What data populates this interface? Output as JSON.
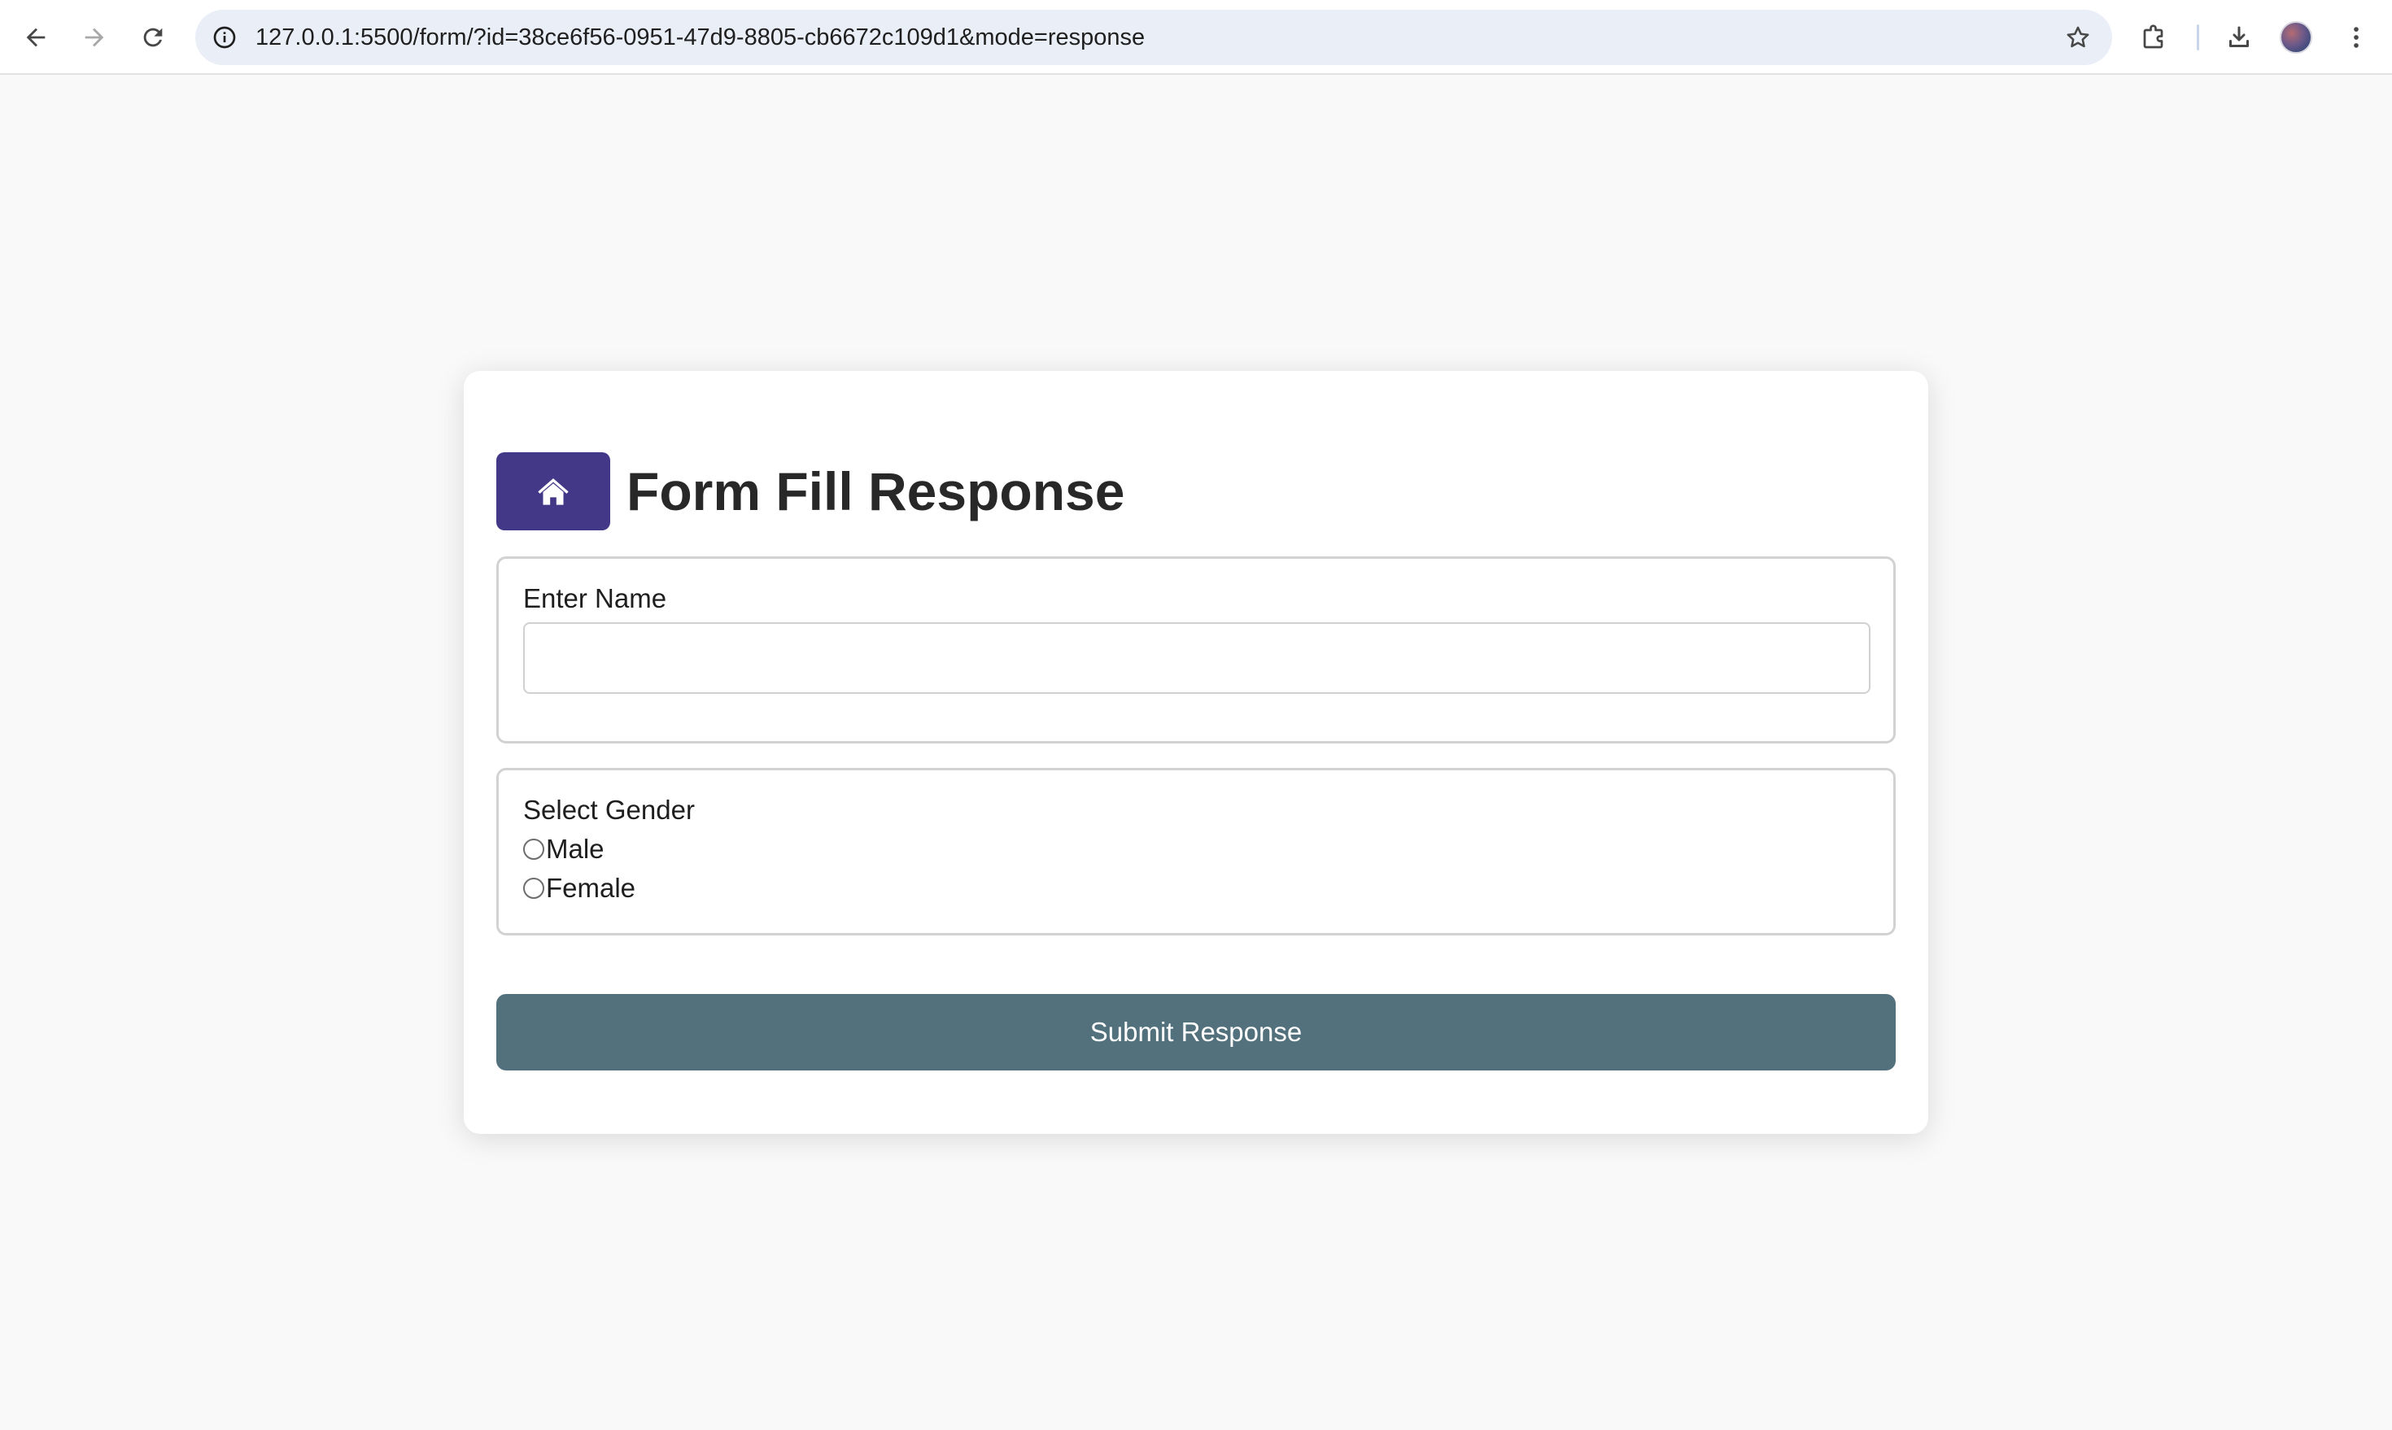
{
  "browser": {
    "url": "127.0.0.1:5500/form/?id=38ce6f56-0951-47d9-8805-cb6672c109d1&mode=response"
  },
  "page": {
    "title": "Form Fill Response"
  },
  "form": {
    "name_field": {
      "label": "Enter Name",
      "value": ""
    },
    "gender_field": {
      "label": "Select Gender",
      "options": [
        "Male",
        "Female"
      ],
      "selected": null
    },
    "submit_label": "Submit Response"
  },
  "colors": {
    "home_button": "#433887",
    "submit_button": "#52717d",
    "background": "#f9f9f9"
  }
}
